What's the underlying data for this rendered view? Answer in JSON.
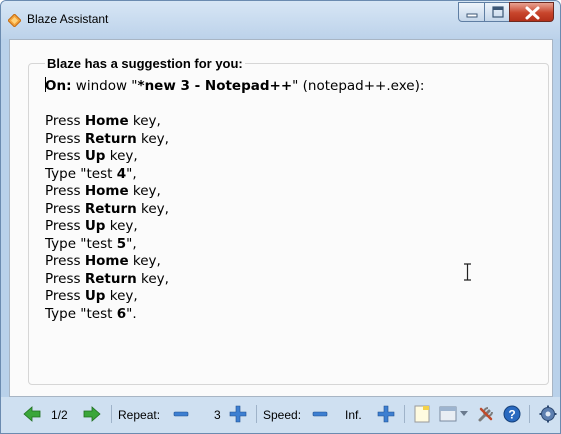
{
  "window": {
    "title": "Blaze Assistant",
    "title_icon": "blaze-diamond-icon",
    "controls": [
      "minimize-icon",
      "maximize-icon",
      "close-icon"
    ]
  },
  "suggestion": {
    "heading": "Blaze has a suggestion for you:",
    "on_label": "On:",
    "on_text_1": " window \"",
    "window_name": "*new 3 - Notepad++",
    "on_text_2": "\" (notepad++.exe):",
    "steps": [
      {
        "prefix": "Press ",
        "strong": "Home",
        "suffix": " key,"
      },
      {
        "prefix": "Press ",
        "strong": "Return",
        "suffix": " key,"
      },
      {
        "prefix": "Press ",
        "strong": "Up",
        "suffix": " key,"
      },
      {
        "prefix": "Type \"test ",
        "strong": "4",
        "suffix": "\","
      },
      {
        "prefix": "Press ",
        "strong": "Home",
        "suffix": " key,"
      },
      {
        "prefix": "Press ",
        "strong": "Return",
        "suffix": " key,"
      },
      {
        "prefix": "Press ",
        "strong": "Up",
        "suffix": " key,"
      },
      {
        "prefix": "Type \"test ",
        "strong": "5",
        "suffix": "\","
      },
      {
        "prefix": "Press ",
        "strong": "Home",
        "suffix": " key,"
      },
      {
        "prefix": "Press ",
        "strong": "Return",
        "suffix": " key,"
      },
      {
        "prefix": "Press ",
        "strong": "Up",
        "suffix": " key,"
      },
      {
        "prefix": "Type \"test ",
        "strong": "6",
        "suffix": "\"."
      }
    ]
  },
  "toolbar": {
    "page_indicator": "1/2",
    "repeat_label": "Repeat:",
    "repeat_value": "3",
    "speed_label": "Speed:",
    "speed_value": "Inf.",
    "icons": [
      "prev-arrow-icon",
      "next-arrow-icon",
      "repeat-decrease-icon",
      "repeat-increase-icon",
      "speed-decrease-icon",
      "speed-increase-icon",
      "note-icon",
      "window-icon",
      "dropdown-icon",
      "tools-icon",
      "help-icon",
      "settings-icon"
    ],
    "colors": {
      "arrow_green": "#3aa63a",
      "minus_blue": "#3d7fd1",
      "help_blue": "#2a6ac0"
    }
  }
}
